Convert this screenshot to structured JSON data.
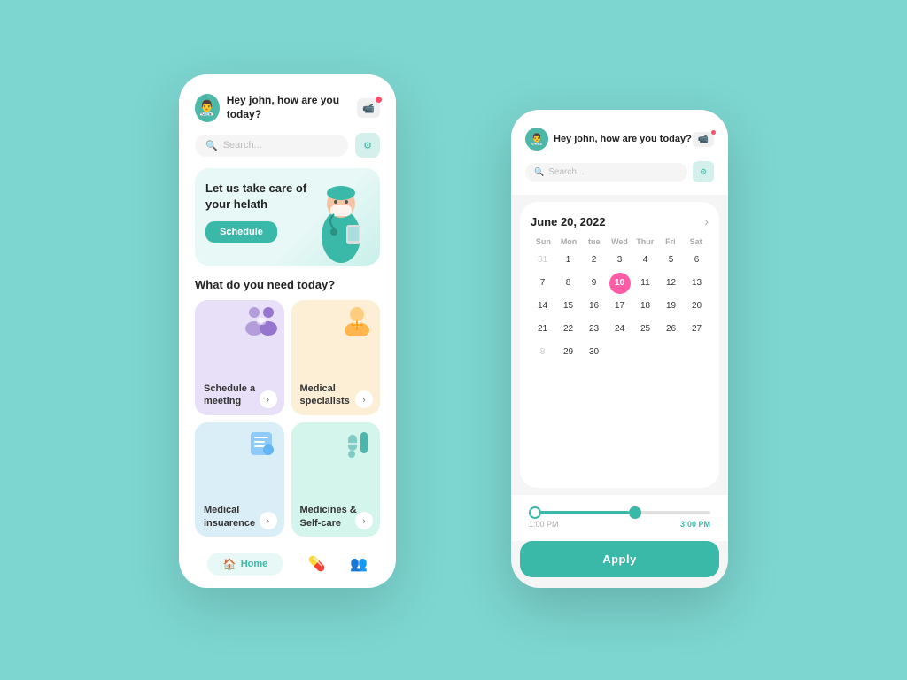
{
  "app": {
    "background_color": "#7dd6d0"
  },
  "phone_left": {
    "header": {
      "greeting": "Hey john, how are you today?",
      "avatar_emoji": "👨‍⚕️",
      "video_icon": "📹"
    },
    "search": {
      "placeholder": "Search..."
    },
    "hero": {
      "text": "Let us take care of your helath",
      "button_label": "Schedule"
    },
    "section_title": "What do you need today?",
    "cards": [
      {
        "label": "Schedule a meeting",
        "color": "gc-1",
        "emoji": "👥"
      },
      {
        "label": "Medical specialists",
        "color": "gc-2",
        "emoji": "🩺"
      },
      {
        "label": "Medical insuarence",
        "color": "gc-3",
        "emoji": "📋"
      },
      {
        "label": "Medicines & Self-care",
        "color": "gc-4",
        "emoji": "💊"
      }
    ],
    "nav": {
      "home_label": "Home",
      "icons": [
        "🏠",
        "💊",
        "👥"
      ]
    }
  },
  "phone_right": {
    "header": {
      "greeting": "Hey john, how are you today?",
      "avatar_emoji": "👨‍⚕️",
      "video_icon": "📹"
    },
    "search": {
      "placeholder": "Search..."
    },
    "calendar": {
      "month_label": "June 20, 2022",
      "day_names": [
        "Sun",
        "Mon",
        "tue",
        "Wed",
        "Thur",
        "Fri",
        "Sat"
      ],
      "weeks": [
        [
          "31",
          "1",
          "2",
          "3",
          "4",
          "5",
          "6"
        ],
        [
          "7",
          "8",
          "9",
          "10",
          "11",
          "12",
          "13"
        ],
        [
          "14",
          "15",
          "16",
          "17",
          "18",
          "19",
          "20"
        ],
        [
          "21",
          "22",
          "23",
          "24",
          "25",
          "26",
          "27"
        ],
        [
          "8",
          "29",
          "30",
          "",
          "",
          "",
          ""
        ]
      ],
      "selected_day": "10",
      "prev_month_days": [
        "31"
      ],
      "next_month_days": [
        "8"
      ]
    },
    "time_slider": {
      "left_label": "1:00 PM",
      "right_label": "3:00 PM"
    },
    "apply_button_label": "Apply"
  }
}
